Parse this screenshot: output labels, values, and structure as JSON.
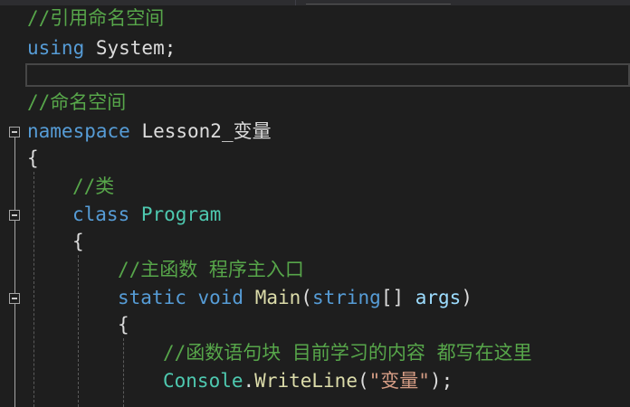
{
  "editor": {
    "lines": {
      "comment_using": "//引用命名空间",
      "using_kw": "using",
      "using_rest": " System;",
      "comment_ns": "//命名空间",
      "ns_kw": "namespace",
      "ns_name": " Lesson2_变量",
      "brace_open_ns": "{",
      "comment_class": "//类",
      "class_kw": "class",
      "class_name": " Program",
      "brace_open_class": "{",
      "comment_main": "//主函数 程序主入口",
      "static_kw": "static",
      "void_kw": " void",
      "main_name": " Main",
      "paren_open": "(",
      "string_kw": "string",
      "array_brackets": "[] ",
      "args_name": "args",
      "paren_close": ")",
      "brace_open_main": "{",
      "comment_block": "//函数语句块 目前学习的内容 都写在这里",
      "console_type": "Console",
      "dot": ".",
      "writeline_name": "WriteLine",
      "call_open": "(",
      "string_literal": "\"变量\"",
      "call_close": ");"
    }
  }
}
